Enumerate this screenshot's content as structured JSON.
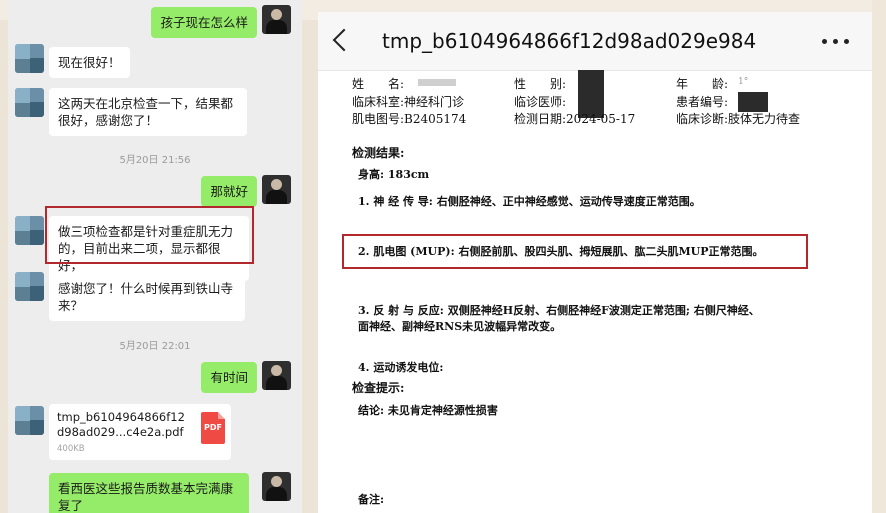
{
  "chat": {
    "messages": [
      {
        "side": "right",
        "text": "孩子现在怎么样"
      },
      {
        "side": "left",
        "text": "现在很好！"
      },
      {
        "side": "left",
        "text": "这两天在北京检查一下，结果都很好，感谢您了！"
      },
      {
        "timestamp": "5月20日 21:56"
      },
      {
        "side": "right",
        "text": "那就好"
      },
      {
        "side": "left",
        "text": "做三项检查都是针对重症肌无力的，目前出来二项，显示都很好，"
      },
      {
        "side": "left",
        "text": "感谢您了！什么时候再到铁山寺来？"
      },
      {
        "timestamp": "5月20日 22:01"
      },
      {
        "side": "right",
        "text": "有时间"
      },
      {
        "side": "left",
        "file": {
          "name": "tmp_b6104964866f12\nd98ad029...c4e2a.pdf",
          "size": "400KB",
          "badge": "PDF"
        }
      },
      {
        "side": "right",
        "text": "看西医这些报告质数基本完满康复了"
      }
    ]
  },
  "viewer": {
    "title": "tmp_b6104964866f12d98ad029e984",
    "more_label": "•••"
  },
  "report": {
    "header": {
      "r1": {
        "name_label": "姓　　名:",
        "sex_label": "性　　别:",
        "age_label": "年　　龄:",
        "age_value": "1°"
      },
      "r2": {
        "dept": "临床科室:神经科门诊",
        "doctor_label": "临诊医师:",
        "patient_id_label": "患者编号:"
      },
      "r3": {
        "emg_id": "肌电图号:B2405174",
        "date": "检测日期:2024-05-17",
        "diagnosis": "临床诊断:肢体无力待查"
      }
    },
    "result_title": "检测结果:",
    "height": "身高: 183cm",
    "item1": "1. 神 经 传 导: 右侧胫神经、正中神经感觉、运动传导速度正常范围。",
    "item2": "2. 肌电图 (MUP): 右侧胫前肌、股四头肌、拇短展肌、肱二头肌MUP正常范围。",
    "item3a": "3. 反 射 与 反应: 双侧胫神经H反射、右侧胫神经F波测定正常范围; 右侧尺神经、",
    "item3b": "面神经、副神经RNS未见波幅异常改变。",
    "item4": "4. 运动诱发电位:",
    "hint_title": "检查提示:",
    "conclusion": "结论: 未见肯定神经源性损害",
    "remarks": "备注:"
  }
}
